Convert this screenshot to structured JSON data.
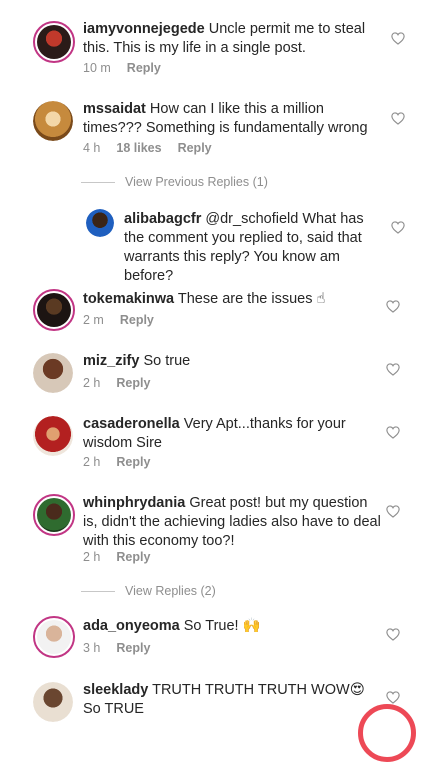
{
  "comments": [
    {
      "user": "iamyvonnejegede",
      "text": "Uncle permit me to steal this. This is my life in a single post.",
      "time": "10 m",
      "reply": "Reply"
    },
    {
      "user": "mssaidat",
      "text": "How can I like this a million times??? Something is fundamentally wrong",
      "time": "4 h",
      "likes": "18 likes",
      "reply": "Reply"
    },
    {
      "user": "alibabagcfr",
      "text": "@dr_schofield What has the comment you replied to, said that warrants this reply? You know am before?"
    },
    {
      "user": "tokemakinwa",
      "text": "These are the issues ☝",
      "time": "2 m",
      "reply": "Reply"
    },
    {
      "user": "miz_zify",
      "text": "So true",
      "time": "2 h",
      "reply": "Reply"
    },
    {
      "user": "casaderonella",
      "text": "Very Apt...thanks for your wisdom Sire",
      "time": "2 h",
      "reply": "Reply"
    },
    {
      "user": "whinphrydania",
      "text": "Great post! but my question is, didn't the achieving ladies also have to deal with this economy too?!",
      "time": "2 h",
      "reply": "Reply"
    },
    {
      "user": "ada_onyeoma",
      "text": "So True! 🙌",
      "time": "3 h",
      "reply": "Reply"
    },
    {
      "user": "sleeklady",
      "text": "TRUTH TRUTH TRUTH WOW😍 So TRUE"
    }
  ],
  "view_previous_replies": "View Previous Replies (1)",
  "view_replies": "View Replies (2)",
  "icons": {
    "like": "heart-outline-icon"
  },
  "colors": {
    "ring": "#c13584",
    "meta": "#8e8e8e",
    "fab_border": "#ed4956"
  }
}
